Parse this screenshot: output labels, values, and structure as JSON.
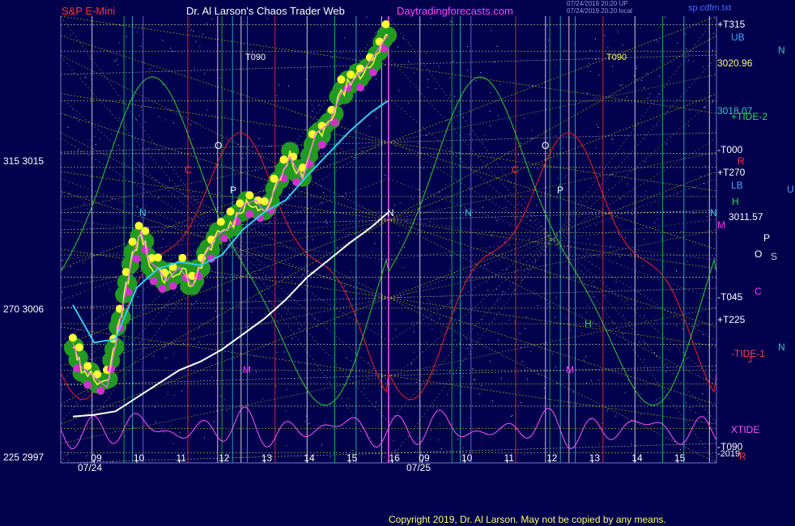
{
  "header": {
    "instrument": "S&P E-Mini",
    "title": "Dr. Al Larson's Chaos Trader Web",
    "site": "Daytradingforecasts.com",
    "stamp_line1": "07/24/2019 20:20 UP",
    "stamp_line2": "07/24/2019 20:20 local",
    "file": "sp.cdfm.txt"
  },
  "footer": {
    "copyright": "Copyright 2019, Dr. Al Larson. May not be copied by any means."
  },
  "left_axis": [
    {
      "label": "315  3015",
      "value": 3015
    },
    {
      "label": "270  3006",
      "value": 3006
    },
    {
      "label": "225  2997",
      "value": 2997
    }
  ],
  "right_axis": [
    {
      "label": "+T315",
      "color": "#ffffff"
    },
    {
      "label": "UB",
      "color": "#4aa3ff"
    },
    {
      "label": "3020.96",
      "color": "#ffff66"
    },
    {
      "label": "3018.07",
      "color": "#33cccc"
    },
    {
      "label": "+TIDE-2",
      "color": "#33dd55"
    },
    {
      "label": "-T000",
      "color": "#ffffff"
    },
    {
      "label": "R",
      "color": "#ff3333"
    },
    {
      "label": "+T270",
      "color": "#ffffff"
    },
    {
      "label": "LB",
      "color": "#4aa3ff"
    },
    {
      "label": "H",
      "color": "#33dd55"
    },
    {
      "label": "3011.57",
      "color": "#ffffff"
    },
    {
      "label": "M",
      "color": "#ff33ff"
    },
    {
      "label": "-T045",
      "color": "#ffffff"
    },
    {
      "label": "+T225",
      "color": "#ffffff"
    },
    {
      "label": "-TIDE-1",
      "color": "#ff4444"
    },
    {
      "label": "J",
      "color": "#ff4444"
    },
    {
      "label": "XTIDE",
      "color": "#ff55ff"
    },
    {
      "label": "-T090",
      "color": "#ffffff"
    },
    {
      "label": "-2019",
      "color": "#ffffff"
    },
    {
      "label": "R",
      "color": "#ff3333"
    }
  ],
  "margin_letters": [
    {
      "text": "N",
      "color": "#33cccc"
    },
    {
      "text": "U",
      "color": "#4aa3ff"
    },
    {
      "text": "P",
      "color": "#ffffff"
    },
    {
      "text": "O",
      "color": "#ffffff"
    },
    {
      "text": "S",
      "color": "#cccccc"
    },
    {
      "text": "C",
      "color": "#ff33ff"
    },
    {
      "text": "N",
      "color": "#33cccc"
    }
  ],
  "in_chart_letters": [
    {
      "text": "T090",
      "color": "#ffffff"
    },
    {
      "text": "T090",
      "color": "#ffff66"
    },
    {
      "text": "O",
      "color": "#ffffff"
    },
    {
      "text": "C",
      "color": "#ff3333"
    },
    {
      "text": "P",
      "color": "#ffffff"
    },
    {
      "text": "N",
      "color": "#33cccc"
    },
    {
      "text": "N",
      "color": "#ffffff"
    },
    {
      "text": "N",
      "color": "#33cccc"
    },
    {
      "text": "O",
      "color": "#ffffff"
    },
    {
      "text": "C",
      "color": "#ff3333"
    },
    {
      "text": "P",
      "color": "#ffffff"
    },
    {
      "text": "H",
      "color": "#33dd55"
    },
    {
      "text": "M",
      "color": "#ff33ff"
    },
    {
      "text": "M",
      "color": "#ff33ff"
    },
    {
      "text": "N",
      "color": "#33cccc"
    }
  ],
  "chart_data": {
    "type": "line",
    "x_hour_ticks": [
      "09",
      "10",
      "11",
      "12",
      "13",
      "14",
      "15",
      "16",
      "09",
      "10",
      "11",
      "12",
      "13",
      "14",
      "15",
      "16"
    ],
    "date_labels": [
      "07/24",
      "07/25"
    ],
    "ylim": [
      2997,
      3023
    ],
    "price": {
      "name": "",
      "hours": [
        8.5,
        8.7,
        9.0,
        9.3,
        9.5,
        9.7,
        9.9,
        10.1,
        10.3,
        10.5,
        10.7,
        11.0,
        11.3,
        11.6,
        11.9,
        12.2,
        12.5,
        12.8,
        13.0,
        13.3,
        13.6,
        13.9,
        14.2,
        14.5,
        14.8,
        15.1,
        15.4,
        15.7,
        15.9
      ],
      "values": [
        3004.0,
        3002.6,
        3002.0,
        3001.4,
        3003.8,
        3006.5,
        3009.0,
        3010.5,
        3008.7,
        3008.3,
        3007.6,
        3008.4,
        3007.3,
        3009.1,
        3010.3,
        3010.7,
        3012.0,
        3012.3,
        3011.6,
        3013.2,
        3014.8,
        3013.5,
        3016.2,
        3016.7,
        3018.5,
        3019.3,
        3020.1,
        3021.2,
        3021.9
      ]
    },
    "fast_average": {
      "hours": [
        8.5,
        9.0,
        9.5,
        10.0,
        10.5,
        11.0,
        11.5,
        12.0,
        12.5,
        13.0,
        13.5,
        14.0,
        14.5,
        15.0,
        15.5,
        15.9
      ],
      "values": [
        3006.2,
        3004.0,
        3004.2,
        3007.2,
        3008.3,
        3008.7,
        3008.5,
        3009.1,
        3010.6,
        3011.6,
        3012.3,
        3013.7,
        3015.0,
        3016.3,
        3017.4,
        3018.07
      ]
    },
    "slow_average": {
      "hours": [
        8.5,
        9.0,
        9.5,
        10.0,
        10.5,
        11.0,
        11.5,
        12.0,
        12.5,
        13.0,
        13.5,
        14.0,
        14.5,
        15.0,
        15.5,
        15.9
      ],
      "values": [
        2999.7,
        2999.8,
        3000.0,
        3000.8,
        3001.6,
        3002.4,
        3002.9,
        3003.6,
        3004.5,
        3005.4,
        3006.5,
        3007.8,
        3008.8,
        3009.8,
        3010.7,
        3011.57
      ]
    },
    "price_levels": [
      3020.96,
      3018.07,
      3011.57
    ],
    "grid": true
  }
}
